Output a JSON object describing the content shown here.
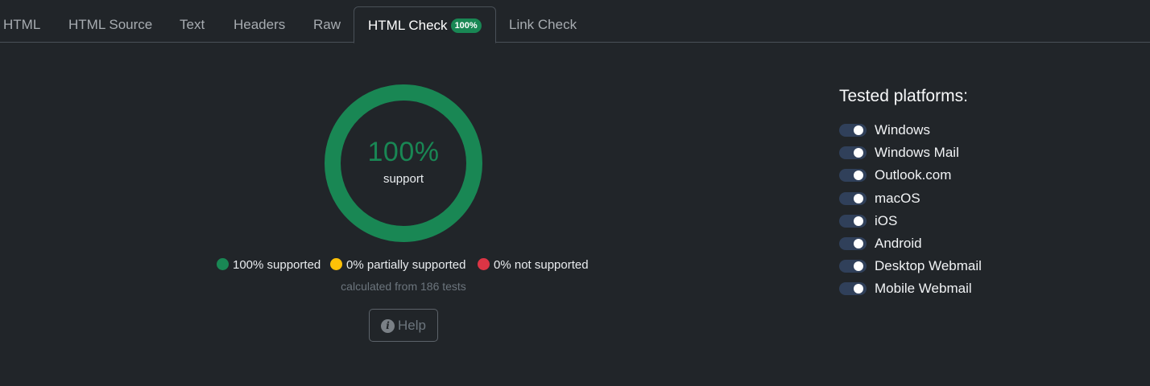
{
  "tabs": [
    {
      "label": "HTML"
    },
    {
      "label": "HTML Source"
    },
    {
      "label": "Text"
    },
    {
      "label": "Headers"
    },
    {
      "label": "Raw"
    },
    {
      "label": "HTML Check",
      "badge": "100%",
      "active": true
    },
    {
      "label": "Link Check"
    }
  ],
  "summary": {
    "value": "100%",
    "caption": "support",
    "supported_fraction": 1.0,
    "colors": {
      "supported": "#198754",
      "partial": "#ffc107",
      "not": "#dc3545"
    }
  },
  "legend": {
    "supported": "100% supported",
    "partial": "0% partially supported",
    "not_supported": "0% not supported"
  },
  "calc_note": "calculated from 186 tests",
  "help": {
    "label": "Help",
    "icon": "info-icon"
  },
  "platforms": {
    "title": "Tested platforms:",
    "items": [
      {
        "label": "Windows",
        "enabled": true
      },
      {
        "label": "Windows Mail",
        "enabled": true
      },
      {
        "label": "Outlook.com",
        "enabled": true
      },
      {
        "label": "macOS",
        "enabled": true
      },
      {
        "label": "iOS",
        "enabled": true
      },
      {
        "label": "Android",
        "enabled": true
      },
      {
        "label": "Desktop Webmail",
        "enabled": true
      },
      {
        "label": "Mobile Webmail",
        "enabled": true
      }
    ]
  }
}
